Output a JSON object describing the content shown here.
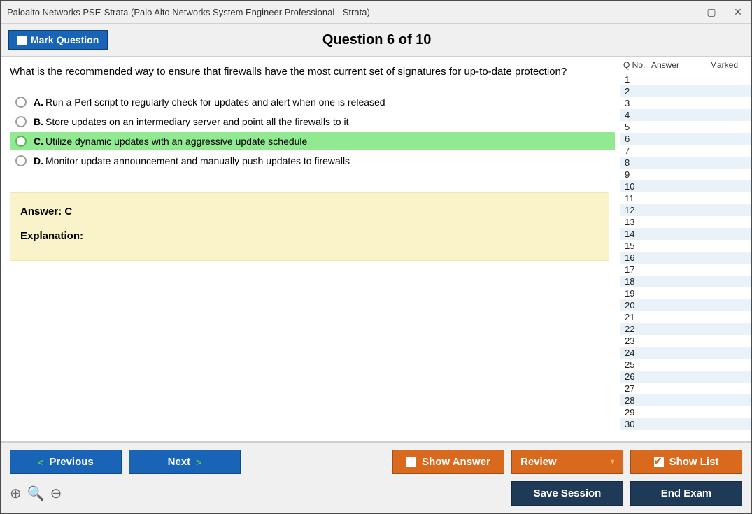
{
  "window": {
    "title": "Paloalto Networks PSE-Strata (Palo Alto Networks System Engineer Professional - Strata)"
  },
  "header": {
    "mark_label": "Mark Question",
    "qnum": "Question 6 of 10"
  },
  "question": {
    "text": "What is the recommended way to ensure that firewalls have the most current set of signatures for up-to-date protection?",
    "options": {
      "a": {
        "letter": "A.",
        "text": "Run a Perl script to regularly check for updates and alert when one is released"
      },
      "b": {
        "letter": "B.",
        "text": "Store updates on an intermediary server and point all the firewalls to it"
      },
      "c": {
        "letter": "C.",
        "text": "Utilize dynamic updates with an aggressive update schedule"
      },
      "d": {
        "letter": "D.",
        "text": "Monitor update announcement and manually push updates to firewalls"
      }
    },
    "answer_line": "Answer: C",
    "explanation_label": "Explanation:"
  },
  "side": {
    "col_qno": "Q No.",
    "col_answer": "Answer",
    "col_marked": "Marked",
    "rows": [
      "1",
      "2",
      "3",
      "4",
      "5",
      "6",
      "7",
      "8",
      "9",
      "10",
      "11",
      "12",
      "13",
      "14",
      "15",
      "16",
      "17",
      "18",
      "19",
      "20",
      "21",
      "22",
      "23",
      "24",
      "25",
      "26",
      "27",
      "28",
      "29",
      "30"
    ]
  },
  "footer": {
    "prev": "Previous",
    "next": "Next",
    "show_answer": "Show Answer",
    "review": "Review",
    "show_list": "Show List",
    "save": "Save Session",
    "end": "End Exam"
  }
}
